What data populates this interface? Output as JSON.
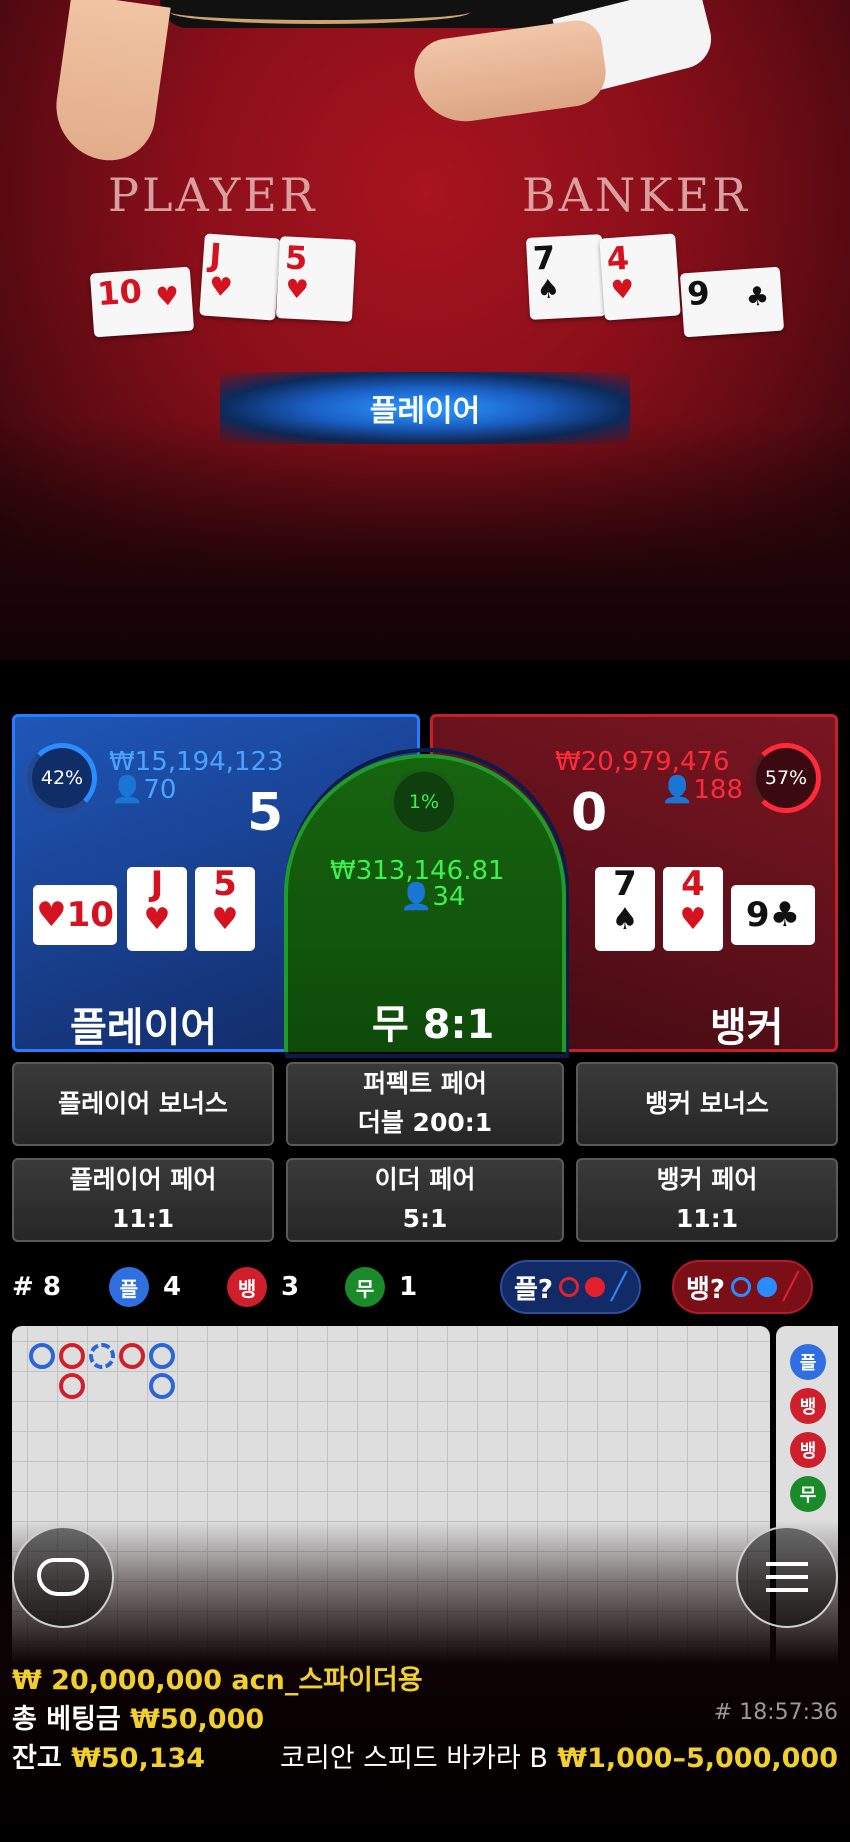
{
  "video": {
    "player_label": "PLAYER",
    "banker_label": "BANKER",
    "result_banner": "플레이어",
    "player_cards": [
      {
        "rank": "10",
        "suit": "♥"
      },
      {
        "rank": "J",
        "suit": "♥"
      },
      {
        "rank": "5",
        "suit": "♥"
      }
    ],
    "banker_cards": [
      {
        "rank": "7",
        "suit": "♠"
      },
      {
        "rank": "4",
        "suit": "♥"
      },
      {
        "rank": "9",
        "suit": "♣"
      }
    ]
  },
  "player": {
    "percent": "42%",
    "amount": "₩15,194,123",
    "bettors": "70",
    "score": "5",
    "label": "플레이어",
    "cards": [
      {
        "rank": "10",
        "suit": "♥"
      },
      {
        "rank": "J",
        "suit": "♥"
      },
      {
        "rank": "5",
        "suit": "♥"
      }
    ]
  },
  "tie": {
    "percent": "1%",
    "amount": "₩313,146.81",
    "bettors": "34",
    "label": "무 8:1"
  },
  "banker": {
    "percent": "57%",
    "amount": "₩20,979,476",
    "bettors": "188",
    "score": "0",
    "label": "뱅커",
    "cards": [
      {
        "rank": "7",
        "suit": "♠"
      },
      {
        "rank": "4",
        "suit": "♥"
      },
      {
        "rank": "9",
        "suit": "♣"
      }
    ]
  },
  "sidebets": {
    "player_bonus": "플레이어 보너스",
    "perfect_pair": {
      "line1": "퍼펙트 페어",
      "line2": "더블 200:1"
    },
    "banker_bonus": "뱅커 보너스",
    "player_pair": {
      "line1": "플레이어 페어",
      "line2": "11:1"
    },
    "either_pair": {
      "line1": "이더 페어",
      "line2": "5:1"
    },
    "banker_pair": {
      "line1": "뱅커 페어",
      "line2": "11:1"
    }
  },
  "stats": {
    "round": "# 8",
    "player_icon": "플",
    "player_count": "4",
    "banker_icon": "뱅",
    "banker_count": "3",
    "tie_icon": "무",
    "tie_count": "1",
    "player_predict": "플?",
    "banker_predict": "뱅?"
  },
  "beadroad": {
    "side_icons": [
      "플",
      "뱅",
      "뱅",
      "무"
    ]
  },
  "footer": {
    "balance_limit": "₩ 20,000,000 acn_스파이더용",
    "total_bet_label": "총 베팅금",
    "total_bet": "₩50,000",
    "time": "# 18:57:36",
    "balance_label": "잔고",
    "balance": "₩50,134",
    "table_name": "코리안 스피드 바카라 B",
    "limits": "₩1,000–5,000,000"
  },
  "colors": {
    "player": "#2b7bff",
    "banker": "#c4212e",
    "tie": "#1f9b2a",
    "gold": "#f1cf2c"
  }
}
